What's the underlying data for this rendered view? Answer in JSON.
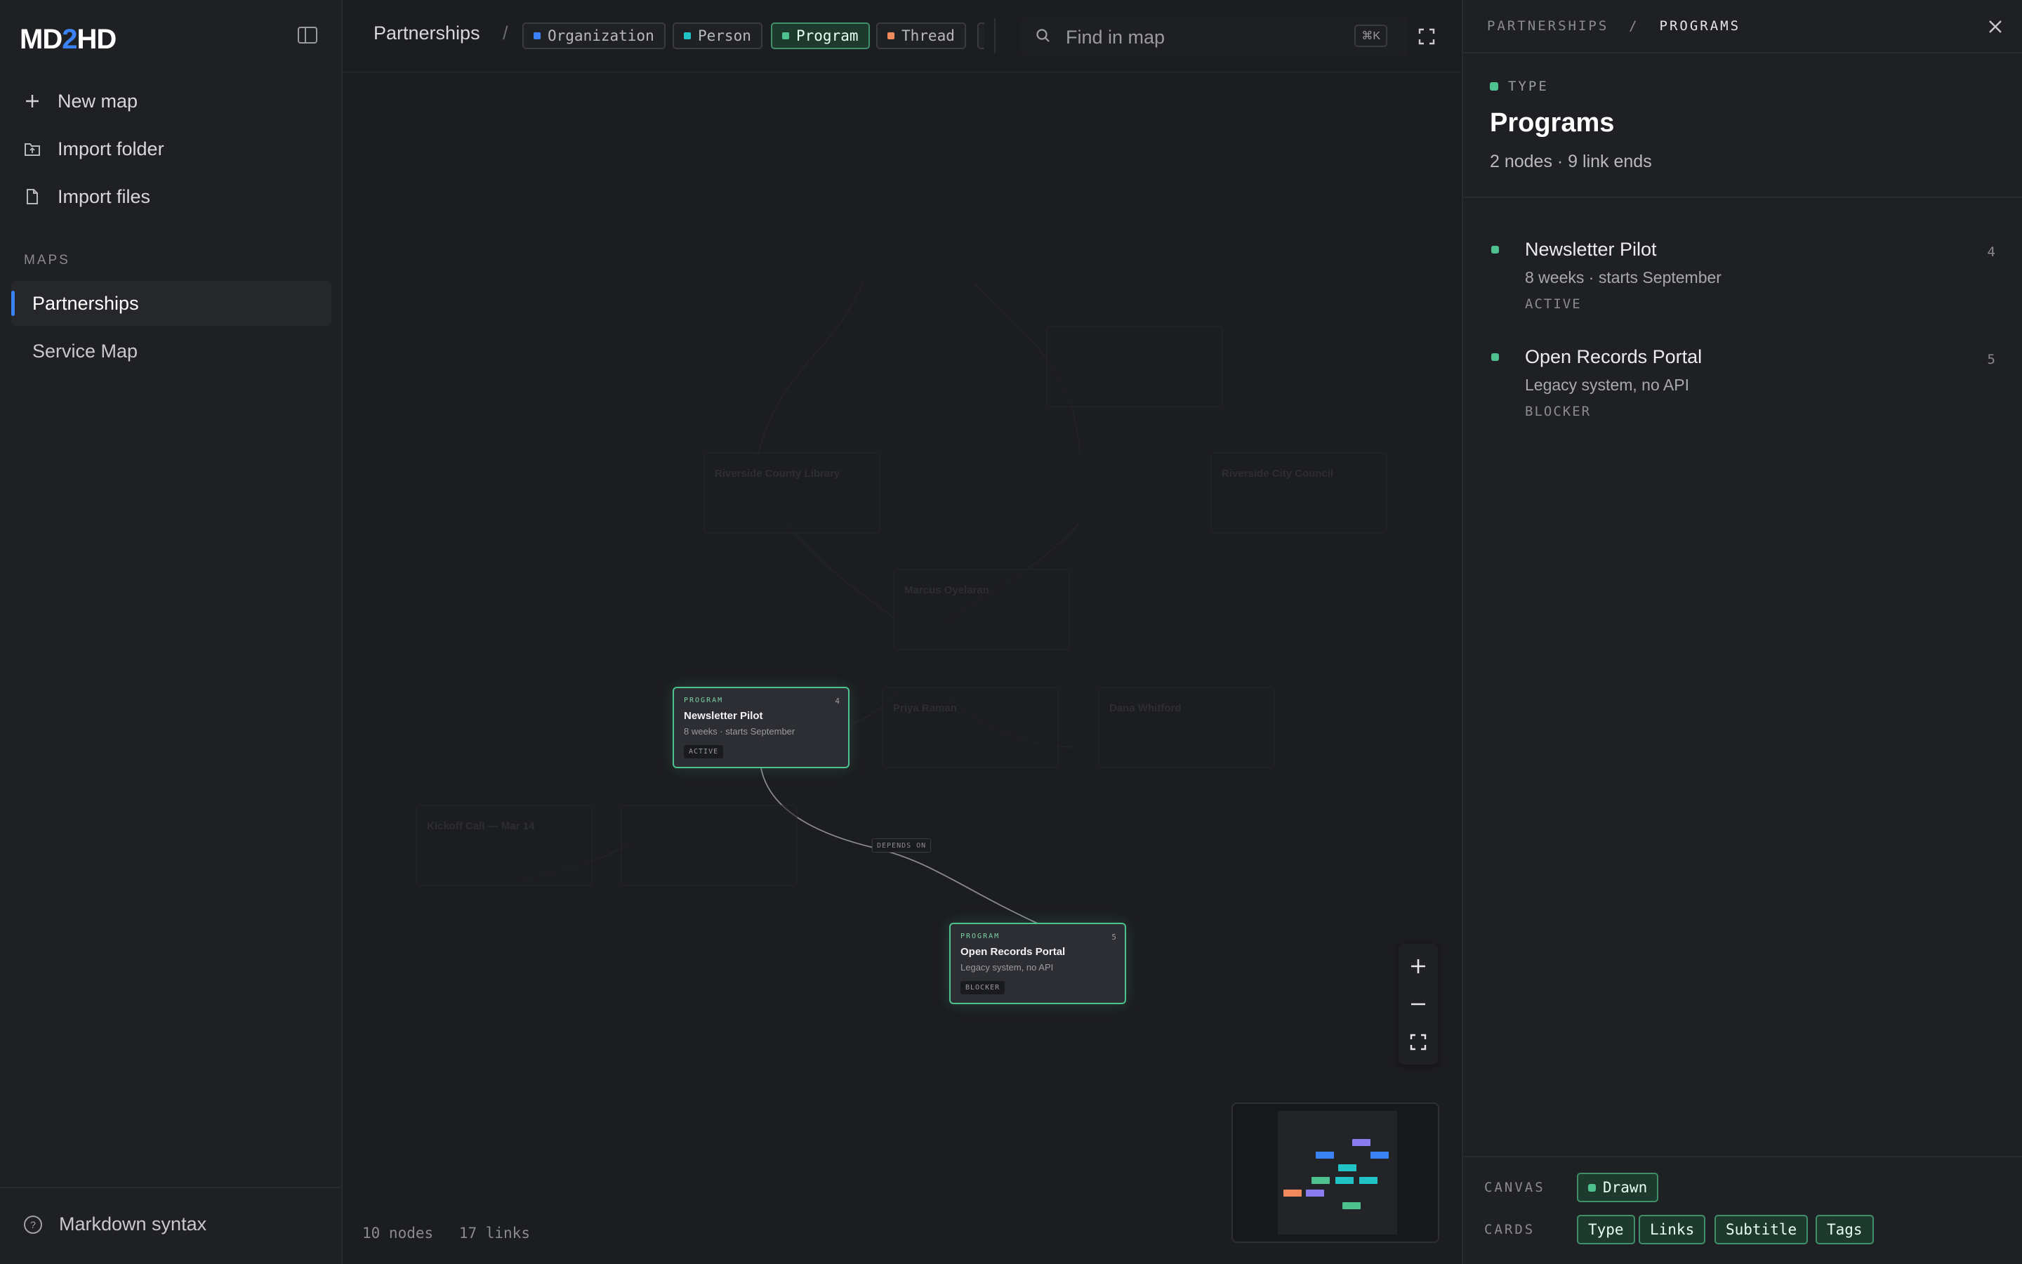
{
  "app": {
    "logo_pre": "MD",
    "logo_two": "2",
    "logo_post": "HD"
  },
  "sidebar": {
    "actions": [
      {
        "label": "New map",
        "icon": "plus-icon"
      },
      {
        "label": "Import folder",
        "icon": "folder-icon"
      },
      {
        "label": "Import files",
        "icon": "file-icon"
      }
    ],
    "maps_heading": "MAPS",
    "maps": [
      {
        "label": "Partnerships",
        "active": true
      },
      {
        "label": "Service Map",
        "active": false
      }
    ],
    "footer_label": "Markdown syntax"
  },
  "topbar": {
    "map_title": "Partnerships",
    "separator": "/",
    "filters": [
      {
        "label": "Organization",
        "color": "#3b82f6",
        "active": false
      },
      {
        "label": "Person",
        "color": "#22c3c7",
        "active": false
      },
      {
        "label": "Program",
        "color": "#4ec28e",
        "active": true
      },
      {
        "label": "Thread",
        "color": "#f08a5d",
        "active": false
      }
    ],
    "search_placeholder": "Find in map",
    "search_shortcut": "⌘K"
  },
  "canvas": {
    "highlighted_nodes": [
      {
        "type": "PROGRAM",
        "title": "Newsletter Pilot",
        "subtitle": "8 weeks · starts September",
        "tag": "ACTIVE",
        "count": "4"
      },
      {
        "type": "PROGRAM",
        "title": "Open Records Portal",
        "subtitle": "Legacy system, no API",
        "tag": "BLOCKER",
        "count": "5"
      }
    ],
    "dimmed_nodes": [
      {
        "title": "Riverside County Library"
      },
      {
        "title": "Riverside City Council"
      },
      {
        "title": "Marcus Oyelaran"
      },
      {
        "title": "Priya Raman"
      },
      {
        "title": "Dana Whitford"
      },
      {
        "title": "Kickoff Call — Mar 14"
      }
    ],
    "edge_label": "DEPENDS ON",
    "stats": {
      "nodes": "10 nodes",
      "links": "17 links"
    }
  },
  "panel": {
    "crumb_root": "PARTNERSHIPS",
    "crumb_sep": "/",
    "crumb_current": "PROGRAMS",
    "type_label": "TYPE",
    "title": "Programs",
    "meta": "2 nodes · 9 link ends",
    "items": [
      {
        "title": "Newsletter Pilot",
        "subtitle": "8 weeks · starts September",
        "tag": "ACTIVE",
        "count": "4"
      },
      {
        "title": "Open Records Portal",
        "subtitle": "Legacy system, no API",
        "tag": "BLOCKER",
        "count": "5"
      }
    ],
    "canvas_label": "CANVAS",
    "canvas_option": "Drawn",
    "cards_label": "CARDS",
    "cards_options": [
      "Type",
      "Links",
      "Subtitle",
      "Tags"
    ]
  },
  "colors": {
    "accent": "#3b82f6",
    "program": "#4ec28e",
    "organization": "#3b82f6",
    "person": "#22c3c7",
    "thread": "#f08a5d"
  }
}
